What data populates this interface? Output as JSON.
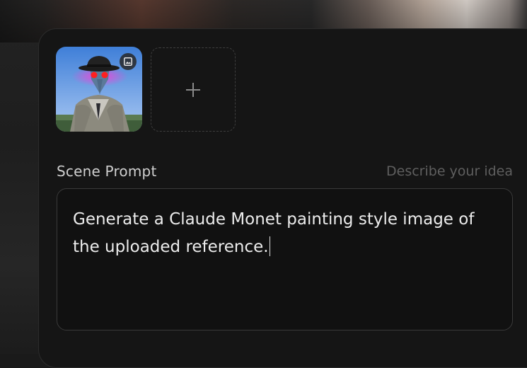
{
  "reference_images": {
    "items": [
      {
        "icon": "image-icon",
        "alt": "uploaded reference"
      }
    ],
    "add_slot": {
      "icon": "plus-icon"
    }
  },
  "scene_prompt": {
    "label": "Scene Prompt",
    "hint": "Describe your idea",
    "value": "Generate a Claude Monet painting style image of the uploaded reference."
  },
  "colors": {
    "panel_bg": "#151515",
    "page_bg": "#1a1a1a",
    "text": "#ececec",
    "label": "#cfcfcf",
    "hint": "#5f5f5f",
    "border": "#3a3a3a"
  }
}
